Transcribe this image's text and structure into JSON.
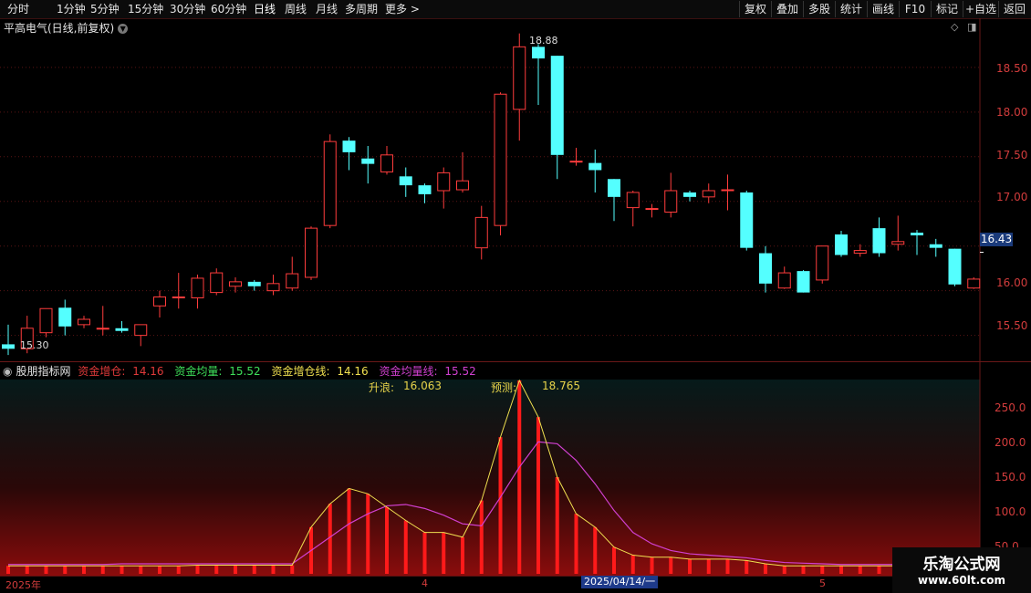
{
  "toolbar": {
    "periods": [
      "分时",
      "1分钟",
      "5分钟",
      "15分钟",
      "30分钟",
      "60分钟",
      "日线",
      "周线",
      "月线",
      "多周期",
      "更多 >"
    ],
    "active_period": "日线",
    "right_buttons": [
      "复权",
      "叠加",
      "多股",
      "统计",
      "画线",
      "F10",
      "标记",
      "+自选",
      "返回"
    ]
  },
  "main_chart": {
    "title": "平高电气(日线,前复权)",
    "current_price": "16.43",
    "high_label": "18.88",
    "low_label": "15.30",
    "y_ticks": [
      "18.50",
      "18.00",
      "17.50",
      "17.00",
      "16.00",
      "15.50"
    ]
  },
  "indicator": {
    "name": "股朋指标网",
    "items": [
      {
        "label": "资金增仓:",
        "value": "14.16",
        "color": "#e03a3a"
      },
      {
        "label": "资金均量:",
        "value": "15.52",
        "color": "#3ee05a"
      },
      {
        "label": "资金增仓线:",
        "value": "14.16",
        "color": "#f0e050"
      },
      {
        "label": "资金均量线:",
        "value": "15.52",
        "color": "#d040d0"
      }
    ],
    "rise_label": "升浪:",
    "rise_value": "16.063",
    "predict_label": "预测:",
    "predict_value": "18.765",
    "y_ticks": [
      "250.0",
      "200.0",
      "150.0",
      "100.0",
      "50.0"
    ]
  },
  "date_axis": {
    "labels": [
      "2025年",
      "4",
      "5"
    ],
    "cursor": "2025/04/14/一"
  },
  "watermark": {
    "line1": "乐淘公式网",
    "line2": "www.60lt.com"
  },
  "colors": {
    "up": "#ff3c3c",
    "down": "#54ffff",
    "bg": "#000000",
    "grid": "#5a1414",
    "ma_line": "#d040d0",
    "vol_line": "#f0e050"
  },
  "chart_data": {
    "type": "candlestick",
    "price_range": [
      15.2,
      19.05
    ],
    "candles": [
      [
        15.4,
        15.35,
        15.62,
        15.28
      ],
      [
        15.35,
        15.58,
        15.72,
        15.3
      ],
      [
        15.53,
        15.8,
        15.8,
        15.48
      ],
      [
        15.81,
        15.6,
        15.9,
        15.5
      ],
      [
        15.62,
        15.68,
        15.72,
        15.58
      ],
      [
        15.58,
        15.58,
        15.83,
        15.5
      ],
      [
        15.58,
        15.55,
        15.66,
        15.53
      ],
      [
        15.5,
        15.62,
        15.62,
        15.38
      ],
      [
        15.83,
        15.93,
        16.0,
        15.7
      ],
      [
        15.93,
        15.93,
        16.2,
        15.8
      ],
      [
        15.92,
        16.14,
        16.18,
        15.8
      ],
      [
        15.98,
        16.2,
        16.25,
        15.95
      ],
      [
        16.05,
        16.1,
        16.15,
        15.98
      ],
      [
        16.1,
        16.05,
        16.12,
        16.0
      ],
      [
        16.0,
        16.08,
        16.18,
        15.95
      ],
      [
        16.03,
        16.19,
        16.38,
        16.0
      ],
      [
        16.15,
        16.7,
        16.72,
        16.12
      ],
      [
        16.73,
        17.67,
        17.75,
        16.7
      ],
      [
        17.68,
        17.55,
        17.72,
        17.35
      ],
      [
        17.48,
        17.42,
        17.62,
        17.2
      ],
      [
        17.33,
        17.52,
        17.62,
        17.3
      ],
      [
        17.28,
        17.18,
        17.38,
        17.05
      ],
      [
        17.18,
        17.08,
        17.2,
        16.98
      ],
      [
        17.12,
        17.32,
        17.38,
        16.92
      ],
      [
        17.13,
        17.23,
        17.55,
        17.1
      ],
      [
        16.48,
        16.82,
        16.95,
        16.35
      ],
      [
        16.73,
        18.2,
        18.22,
        16.62
      ],
      [
        18.03,
        18.73,
        18.88,
        17.68
      ],
      [
        18.73,
        18.6,
        18.76,
        18.08
      ],
      [
        18.63,
        17.52,
        18.63,
        17.25
      ],
      [
        17.45,
        17.45,
        17.6,
        17.4
      ],
      [
        17.43,
        17.35,
        17.58,
        17.1
      ],
      [
        17.25,
        17.05,
        17.25,
        16.78
      ],
      [
        16.93,
        17.1,
        17.12,
        16.72
      ],
      [
        16.92,
        16.92,
        16.97,
        16.82
      ],
      [
        16.88,
        17.12,
        17.32,
        16.82
      ],
      [
        17.1,
        17.05,
        17.12,
        17.0
      ],
      [
        17.05,
        17.12,
        17.2,
        16.98
      ],
      [
        17.12,
        17.13,
        17.3,
        16.9
      ],
      [
        17.1,
        16.48,
        17.12,
        16.45
      ],
      [
        16.42,
        16.08,
        16.5,
        15.98
      ],
      [
        16.03,
        16.2,
        16.27,
        16.02
      ],
      [
        16.22,
        15.98,
        16.23,
        15.98
      ],
      [
        16.12,
        16.5,
        16.5,
        16.08
      ],
      [
        16.63,
        16.4,
        16.67,
        16.38
      ],
      [
        16.42,
        16.45,
        16.52,
        16.38
      ],
      [
        16.7,
        16.42,
        16.82,
        16.38
      ],
      [
        16.52,
        16.55,
        16.84,
        16.45
      ],
      [
        16.65,
        16.62,
        16.68,
        16.4
      ],
      [
        16.52,
        16.48,
        16.58,
        16.38
      ],
      [
        16.47,
        16.07,
        16.47,
        16.05
      ],
      [
        16.03,
        16.13,
        16.15,
        16.02
      ]
    ],
    "indicator_range": [
      0,
      290
    ],
    "bars": [
      12,
      12,
      12,
      12,
      12,
      12,
      12,
      12,
      12,
      12,
      13,
      13,
      13,
      13,
      13,
      13,
      70,
      105,
      128,
      120,
      100,
      80,
      62,
      62,
      55,
      110,
      205,
      290,
      235,
      145,
      90,
      70,
      40,
      28,
      25,
      25,
      22,
      22,
      22,
      20,
      15,
      12,
      12,
      12,
      12,
      12,
      12,
      12,
      12,
      12,
      12,
      12
    ],
    "fund_line": [
      12,
      12,
      12,
      12,
      12,
      12,
      12,
      12,
      12,
      12,
      13,
      13,
      13,
      13,
      13,
      13,
      70,
      105,
      128,
      120,
      100,
      80,
      62,
      62,
      55,
      110,
      205,
      290,
      235,
      145,
      90,
      70,
      40,
      28,
      25,
      25,
      22,
      22,
      22,
      20,
      15,
      12,
      12,
      12,
      12,
      12,
      12,
      12,
      12,
      12,
      12,
      12
    ],
    "avg_line": [
      14,
      14,
      14,
      14,
      14,
      14,
      15,
      15,
      15,
      15,
      15,
      15,
      15,
      15,
      15,
      15,
      35,
      55,
      75,
      90,
      102,
      104,
      98,
      88,
      75,
      72,
      115,
      160,
      198,
      195,
      170,
      135,
      95,
      62,
      45,
      35,
      30,
      28,
      26,
      24,
      20,
      17,
      16,
      15,
      14,
      14,
      14,
      14,
      14,
      14,
      14,
      14
    ]
  }
}
